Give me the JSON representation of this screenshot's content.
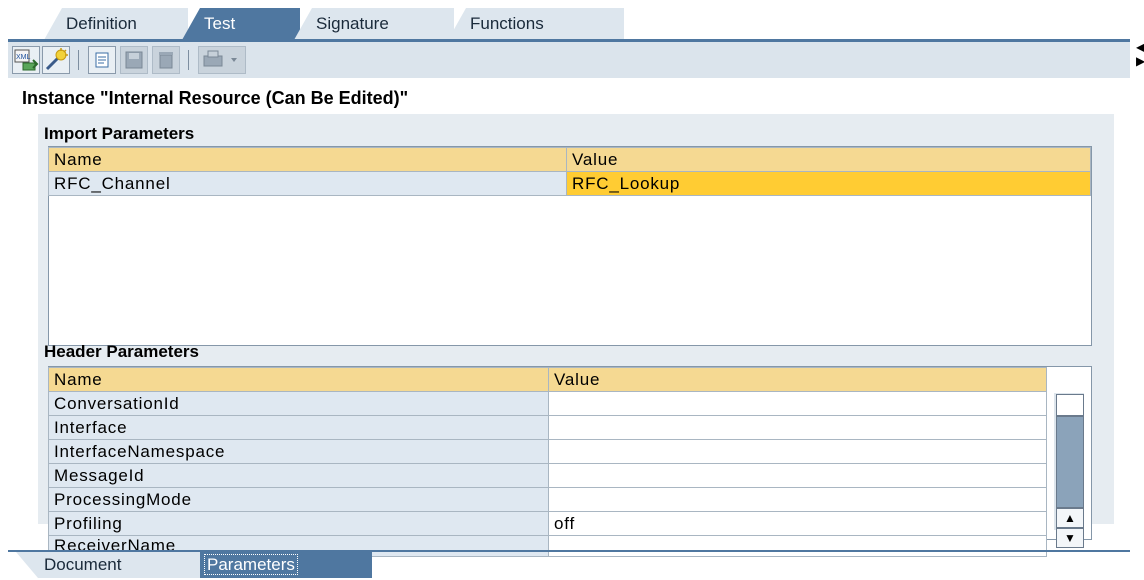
{
  "tabs": [
    "Definition",
    "Test",
    "Signature",
    "Functions"
  ],
  "active_tab": "Test",
  "toolbar": {
    "buttons": [
      "xml-icon",
      "wizard-icon",
      "new-document-icon",
      "save-icon",
      "delete-icon",
      "print-icon",
      "dropdown-arrow-icon"
    ]
  },
  "instance_title": "Instance \"Internal Resource (Can Be Edited)\"",
  "import_parameters": {
    "title": "Import Parameters",
    "columns": [
      "Name",
      "Value"
    ],
    "rows": [
      {
        "name": "RFC_Channel",
        "value": "RFC_Lookup"
      }
    ]
  },
  "header_parameters": {
    "title": "Header Parameters",
    "columns": [
      "Name",
      "Value"
    ],
    "rows": [
      {
        "name": "ConversationId",
        "value": ""
      },
      {
        "name": "Interface",
        "value": ""
      },
      {
        "name": "InterfaceNamespace",
        "value": ""
      },
      {
        "name": "MessageId",
        "value": ""
      },
      {
        "name": "ProcessingMode",
        "value": ""
      },
      {
        "name": "Profiling",
        "value": "off"
      },
      {
        "name": "ReceiverName",
        "value": ""
      }
    ]
  },
  "bottom_tabs": [
    "Document",
    "Parameters"
  ],
  "active_bottom_tab": "Parameters",
  "colors": {
    "accent": "#4f77a0",
    "header_row": "#f5d992",
    "selected_value": "#ffcc33",
    "panel": "#e6ecf1"
  }
}
